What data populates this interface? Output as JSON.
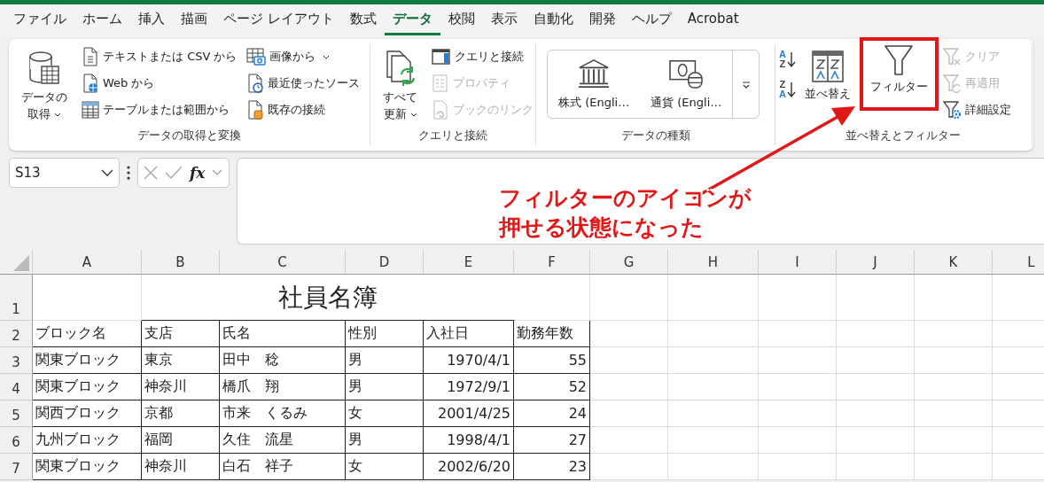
{
  "tabs": [
    {
      "label": "ファイル",
      "selected": false
    },
    {
      "label": "ホーム",
      "selected": false
    },
    {
      "label": "挿入",
      "selected": false
    },
    {
      "label": "描画",
      "selected": false
    },
    {
      "label": "ページ レイアウト",
      "selected": false
    },
    {
      "label": "数式",
      "selected": false
    },
    {
      "label": "データ",
      "selected": true
    },
    {
      "label": "校閲",
      "selected": false
    },
    {
      "label": "表示",
      "selected": false
    },
    {
      "label": "自動化",
      "selected": false
    },
    {
      "label": "開発",
      "selected": false
    },
    {
      "label": "ヘルプ",
      "selected": false
    },
    {
      "label": "Acrobat",
      "selected": false
    }
  ],
  "ribbon": [
    {
      "label": "データの取得と変換",
      "columns": [
        {
          "kind": "large",
          "items": [
            {
              "lines": [
                "データの",
                "取得"
              ],
              "dropdown": true,
              "disabled": false,
              "highlighted": false
            }
          ]
        },
        {
          "kind": "stack",
          "items": [
            {
              "label": "テキストまたは CSV から",
              "dropdown": false,
              "disabled": false
            },
            {
              "label": "Web から",
              "dropdown": false,
              "disabled": false
            },
            {
              "label": "テーブルまたは範囲から",
              "dropdown": false,
              "disabled": false
            }
          ]
        },
        {
          "kind": "stack",
          "items": [
            {
              "label": "画像から",
              "dropdown": true,
              "disabled": false
            },
            {
              "label": "最近使ったソース",
              "dropdown": false,
              "disabled": false
            },
            {
              "label": "既存の接続",
              "dropdown": false,
              "disabled": false
            }
          ]
        }
      ]
    },
    {
      "label": "クエリと接続",
      "columns": [
        {
          "kind": "large",
          "items": [
            {
              "lines": [
                "すべて",
                "更新"
              ],
              "dropdown": true,
              "disabled": false,
              "highlighted": false
            }
          ]
        },
        {
          "kind": "stack",
          "items": [
            {
              "label": "クエリと接続",
              "dropdown": false,
              "disabled": false
            },
            {
              "label": "プロパティ",
              "dropdown": false,
              "disabled": true
            },
            {
              "label": "ブックのリンク",
              "dropdown": false,
              "disabled": true
            }
          ]
        }
      ]
    },
    {
      "label": "データの種類",
      "columns": [
        {
          "kind": "gallery",
          "items": [
            {
              "label": "株式 (Engli…"
            },
            {
              "label": "通貨 (Engli…"
            }
          ]
        }
      ]
    },
    {
      "label": "並べ替えとフィルター",
      "columns": [
        {
          "kind": "sort",
          "items": [
            {
              "label": "A",
              "sub": "Z"
            },
            {
              "label": "Z",
              "sub": "A"
            }
          ]
        },
        {
          "kind": "large",
          "items": [
            {
              "lines": [
                "並べ替え"
              ],
              "dropdown": false,
              "disabled": false,
              "highlighted": false
            }
          ]
        },
        {
          "kind": "large",
          "items": [
            {
              "lines": [
                "フィルター"
              ],
              "dropdown": false,
              "disabled": false,
              "highlighted": true
            }
          ]
        },
        {
          "kind": "stack",
          "items": [
            {
              "label": "クリア",
              "dropdown": false,
              "disabled": true
            },
            {
              "label": "再適用",
              "dropdown": false,
              "disabled": true
            },
            {
              "label": "詳細設定",
              "dropdown": false,
              "disabled": false
            }
          ]
        }
      ]
    }
  ],
  "formula_bar": {
    "name_box": "S13",
    "fx": "fx"
  },
  "annotation": {
    "lines": [
      "フィルターのアイコンが",
      "押せる状態になった"
    ]
  },
  "sheet": {
    "columns": [
      "A",
      "B",
      "C",
      "D",
      "E",
      "F",
      "G",
      "H",
      "I",
      "J",
      "K",
      "L"
    ],
    "title": "社員名簿",
    "rows": [
      {
        "number": "1"
      },
      {
        "number": "2",
        "cells": [
          "ブロック名",
          "支店",
          "氏名",
          "性別",
          "入社日",
          "勤務年数"
        ]
      },
      {
        "number": "3",
        "cells": [
          "関東ブロック",
          "東京",
          "田中　稔",
          "男",
          "1970/4/1",
          "55"
        ]
      },
      {
        "number": "4",
        "cells": [
          "関東ブロック",
          "神奈川",
          "橋爪　翔",
          "男",
          "1972/9/1",
          "52"
        ]
      },
      {
        "number": "5",
        "cells": [
          "関西ブロック",
          "京都",
          "市来　くるみ",
          "女",
          "2001/4/25",
          "24"
        ]
      },
      {
        "number": "6",
        "cells": [
          "九州ブロック",
          "福岡",
          "久住　流星",
          "男",
          "1998/4/1",
          "27"
        ]
      },
      {
        "number": "7",
        "cells": [
          "関東ブロック",
          "神奈川",
          "白石　祥子",
          "女",
          "2002/6/20",
          "23"
        ]
      }
    ]
  }
}
